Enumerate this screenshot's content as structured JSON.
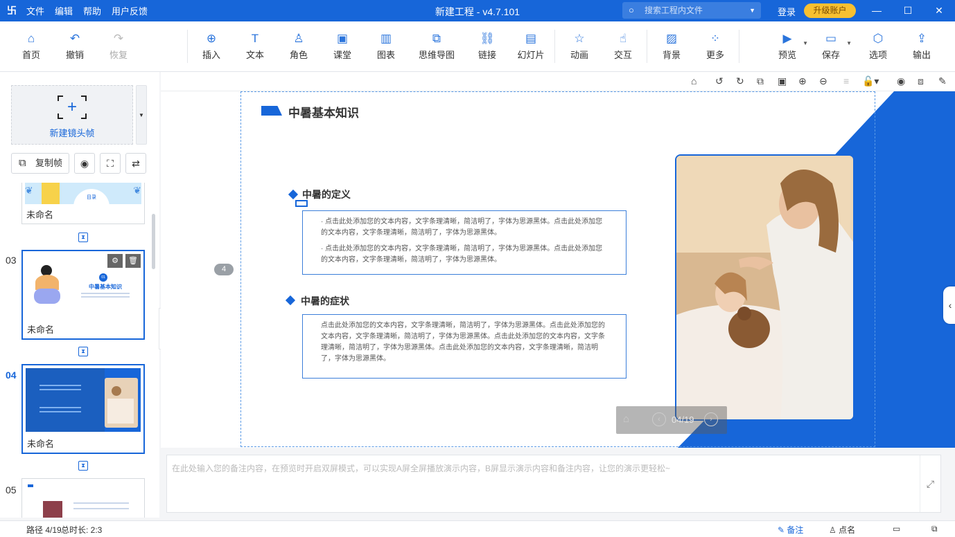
{
  "titlebar": {
    "app_icon": "卐",
    "menu": [
      "文件",
      "编辑",
      "帮助",
      "用户反馈"
    ],
    "title": "新建工程 - v4.7.101",
    "search_placeholder": "搜索工程内文件",
    "login": "登录",
    "upgrade": "升级账户",
    "colors": {
      "brand": "#1766d9",
      "upgrade": "#f7c031"
    }
  },
  "toolbar": {
    "items": [
      {
        "label": "首页",
        "icon": "home-icon",
        "glyph": "⌂"
      },
      {
        "label": "撤销",
        "icon": "undo-icon",
        "glyph": "↶"
      },
      {
        "label": "恢复",
        "icon": "redo-icon",
        "glyph": "↷"
      },
      {
        "label": "插入",
        "icon": "insert-icon",
        "glyph": "⊕"
      },
      {
        "label": "文本",
        "icon": "text-icon",
        "glyph": "T"
      },
      {
        "label": "角色",
        "icon": "role-icon",
        "glyph": "♙"
      },
      {
        "label": "课堂",
        "icon": "classroom-icon",
        "glyph": "▣"
      },
      {
        "label": "图表",
        "icon": "chart-icon",
        "glyph": "▥"
      },
      {
        "label": "思维导图",
        "icon": "mindmap-icon",
        "glyph": "⧉"
      },
      {
        "label": "链接",
        "icon": "link-icon",
        "glyph": "⛓"
      },
      {
        "label": "幻灯片",
        "icon": "slideshow-icon",
        "glyph": "▤"
      },
      {
        "label": "动画",
        "icon": "animation-icon",
        "glyph": "☆"
      },
      {
        "label": "交互",
        "icon": "interaction-icon",
        "glyph": "☝"
      },
      {
        "label": "背景",
        "icon": "background-icon",
        "glyph": "▨"
      },
      {
        "label": "更多",
        "icon": "more-icon",
        "glyph": "⁘"
      },
      {
        "label": "预览",
        "icon": "preview-icon",
        "glyph": "▶"
      },
      {
        "label": "保存",
        "icon": "save-icon",
        "glyph": "▭"
      },
      {
        "label": "选项",
        "icon": "options-icon",
        "glyph": "⬡"
      },
      {
        "label": "输出",
        "icon": "export-icon",
        "glyph": "⇪"
      }
    ]
  },
  "left": {
    "new_frame": "新建镜头帧",
    "copy_frame": "复制帧",
    "slides": [
      {
        "num": "",
        "name": "未命名",
        "thumb_text": "目录"
      },
      {
        "num": "03",
        "name": "未命名",
        "thumb_title": "中暑基本知识",
        "thumb_badge": "01"
      },
      {
        "num": "04",
        "name": "未命名"
      },
      {
        "num": "05",
        "name": ""
      }
    ]
  },
  "canvas": {
    "heading": "中暑基本知识",
    "section1": "中暑的定义",
    "section1_p1": "· 点击此处添加您的文本内容，文字条理清晰，简洁明了，字体为思源黑体。点击此处添加您的文本内容，文字条理清晰，简洁明了，字体为思源黑体。",
    "section1_p2": "· 点击此处添加您的文本内容，文字条理清晰，简洁明了，字体为思源黑体。点击此处添加您的文本内容，文字条理清晰，简洁明了，字体为思源黑体。",
    "section2": "中暑的症状",
    "section2_p": "点击此处添加您的文本内容，文字条理清晰，简洁明了，字体为思源黑体。点击此处添加您的文本内容，文字条理清晰，简洁明了，字体为思源黑体。点击此处添加您的文本内容，文字条理清晰，简洁明了，字体为思源黑体。点击此处添加您的文本内容，文字条理清晰，简洁明了，字体为思源黑体。",
    "page": "04/19",
    "frame_badge": "4"
  },
  "notes_placeholder": "在此处输入您的备注内容，在预览时开启双屏模式，可以实现A屏全屏播放演示内容，B屏显示演示内容和备注内容，让您的演示更轻松~",
  "status": {
    "path": "路径 4/19",
    "duration": "总时长: 2:3",
    "notes": "备注",
    "rollcall": "点名"
  }
}
